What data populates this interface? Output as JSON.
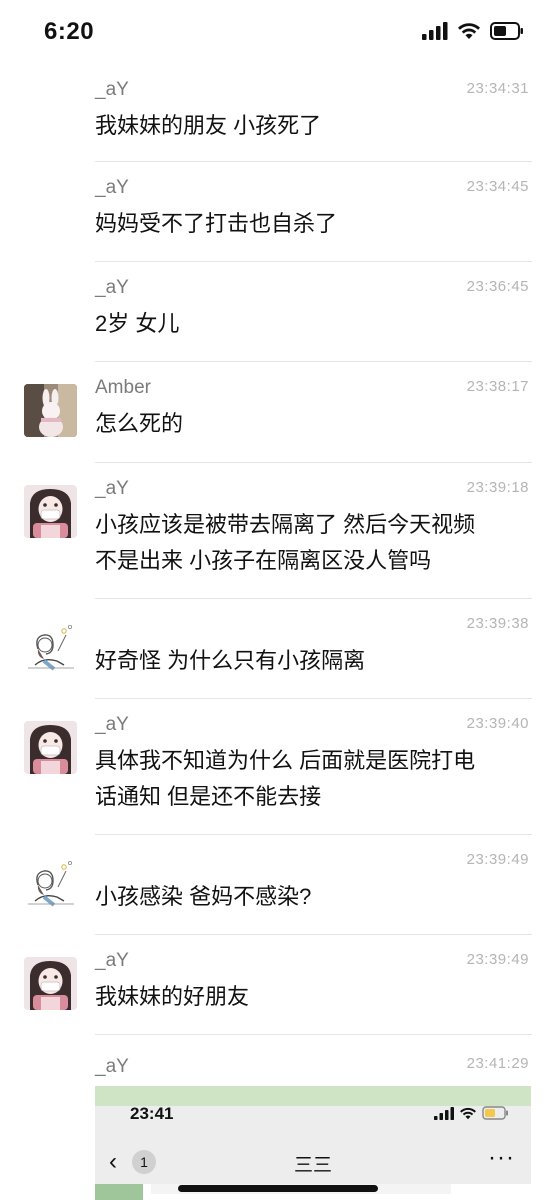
{
  "status_bar": {
    "time": "6:20"
  },
  "messages": [
    {
      "sender": "_aY",
      "time": "23:34:31",
      "text": [
        "我妹妹的朋友 小孩死了"
      ],
      "avatar": "none"
    },
    {
      "sender": "_aY",
      "time": "23:34:45",
      "text": [
        "妈妈受不了打击也自杀了"
      ],
      "avatar": "none"
    },
    {
      "sender": "_aY",
      "time": "23:36:45",
      "text": [
        "2岁 女儿"
      ],
      "avatar": "none"
    },
    {
      "sender": "Amber",
      "time": "23:38:17",
      "text": [
        "怎么死的"
      ],
      "avatar": "rabbit-photo-avatar"
    },
    {
      "sender": "_aY",
      "time": "23:39:18",
      "text": [
        "小孩应该是被带去隔离了 然后今天视频",
        "不是出来 小孩子在隔离区没人管吗"
      ],
      "avatar": "anime-girl-avatar"
    },
    {
      "sender": "",
      "time": "23:39:38",
      "text": [
        "好奇怪 为什么只有小孩隔离"
      ],
      "avatar": "sketch-girl-avatar"
    },
    {
      "sender": "_aY",
      "time": "23:39:40",
      "text": [
        "具体我不知道为什么 后面就是医院打电",
        "话通知 但是还不能去接"
      ],
      "avatar": "anime-girl-avatar"
    },
    {
      "sender": "",
      "time": "23:39:49",
      "text": [
        "小孩感染 爸妈不感染?"
      ],
      "avatar": "sketch-girl-avatar"
    },
    {
      "sender": "_aY",
      "time": "23:39:49",
      "text": [
        "我妹妹的好朋友"
      ],
      "avatar": "anime-girl-avatar"
    },
    {
      "sender": "_aY",
      "time": "23:41:29",
      "text": [],
      "avatar": "none"
    }
  ],
  "embedded_screenshot": {
    "time": "23:41",
    "back_badge": "1",
    "title": "三三",
    "more": "···"
  }
}
